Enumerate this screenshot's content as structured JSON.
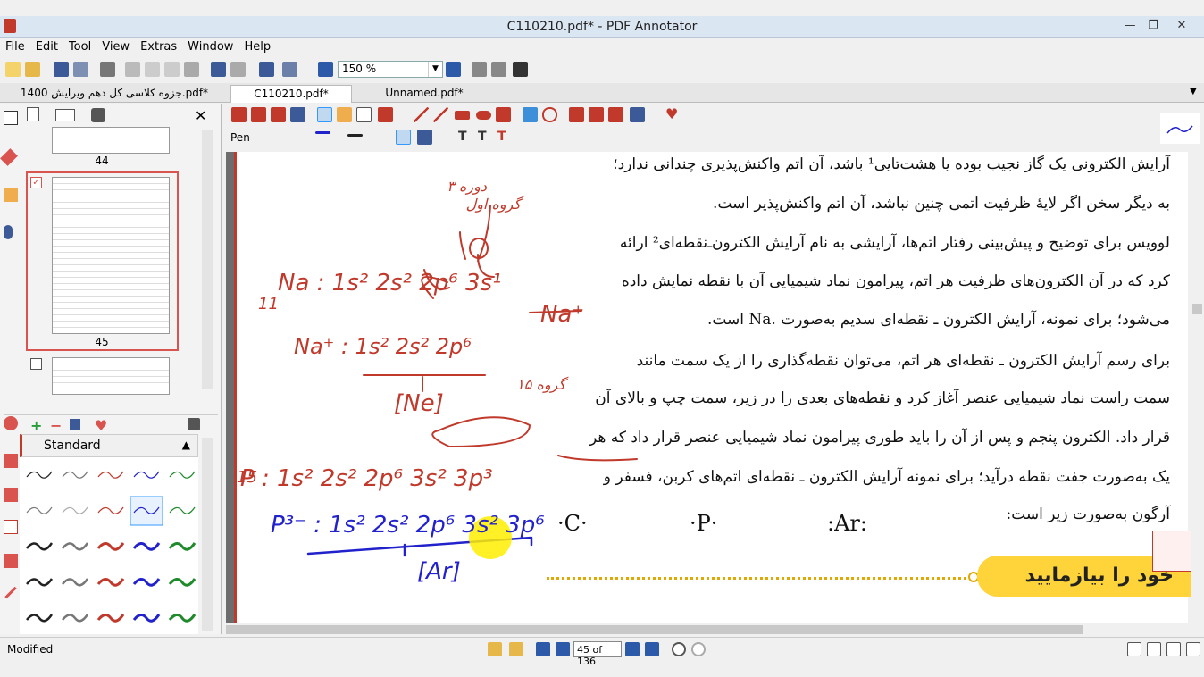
{
  "window": {
    "title": "C110210.pdf* - PDF Annotator"
  },
  "menu": [
    "File",
    "Edit",
    "Tool",
    "View",
    "Extras",
    "Window",
    "Help"
  ],
  "toolbar": {
    "zoom": "150 %"
  },
  "tabs": [
    {
      "label": "جزوه کلاسی کل دهم ویرایش 1400.pdf*"
    },
    {
      "label": "C110210.pdf*"
    },
    {
      "label": "Unnamed.pdf*"
    }
  ],
  "toolbar2": {
    "tool_label": "Pen"
  },
  "thumbnails": {
    "pages": [
      "44",
      "45"
    ]
  },
  "pens": {
    "title": "Standard"
  },
  "document": {
    "lines": [
      "آرایش الکترونی یک گاز نجیب بوده یا هشت‌تایی¹ باشد، آن اتم واکنش‌پذیری چندانی ندارد؛",
      "به دیگر سخن اگر لایهٔ ظرفیت اتمی چنین نباشد، آن اتم واکنش‌پذیر است.",
      "لوویس برای توضیح و پیش‌بینی رفتار اتم‌ها، آرایشی به نام آرایش الکترون‌ـ‌نقطه‌ای² ارائه",
      "کرد که در آن الکترون‌های ظرفیت هر اتم، پیرامون نماد شیمیایی آن با نقطه نمایش داده",
      "می‌شود؛ برای نمونه، آرایش الکترون ـ نقطه‌ای سدیم به‌صورت  .Na  است.",
      "برای رسم آرایش الکترون ـ نقطه‌ای هر اتم، می‌توان نقطه‌گذاری را از یک سمت مانند",
      "سمت راست نماد شیمیایی عنصر آغاز کرد و نقطه‌های بعدی را در زیر، سمت چپ و بالای آن",
      "قرار داد. الکترون پنجم و پس از آن را باید طوری پیرامون نماد شیمیایی عنصر قرار داد که هر",
      "یک به‌صورت جفت نقطه درآید؛ برای نمونه آرایش الکترون ـ نقطه‌ای اتم‌های کربن، فسفر و",
      "آرگون به‌صورت زیر است:"
    ],
    "symbols": [
      ":Ar:",
      "·P·",
      "·C·"
    ],
    "banner": "خود را بیازمایید"
  },
  "handwriting": {
    "na": "Na : 1s² 2s² 2p⁶ 3s¹",
    "na_ion": "Na⁺ : 1s² 2s² 2p⁶",
    "ne": "[Ne]",
    "p": "P : 1s² 2s² 2p⁶ 3s² 3p³",
    "p_ion": "P³⁻ : 1s² 2s² 2p⁶ 3s² 3p⁶",
    "ar": "[Ar]",
    "n11": "11",
    "n15": "15",
    "na_plus": "Na⁺",
    "group1": "گروه اول",
    "period3": "دوره ۳",
    "group15": "گروه ۱۵"
  },
  "status": {
    "text": "Modified",
    "page": "45 of 136"
  }
}
